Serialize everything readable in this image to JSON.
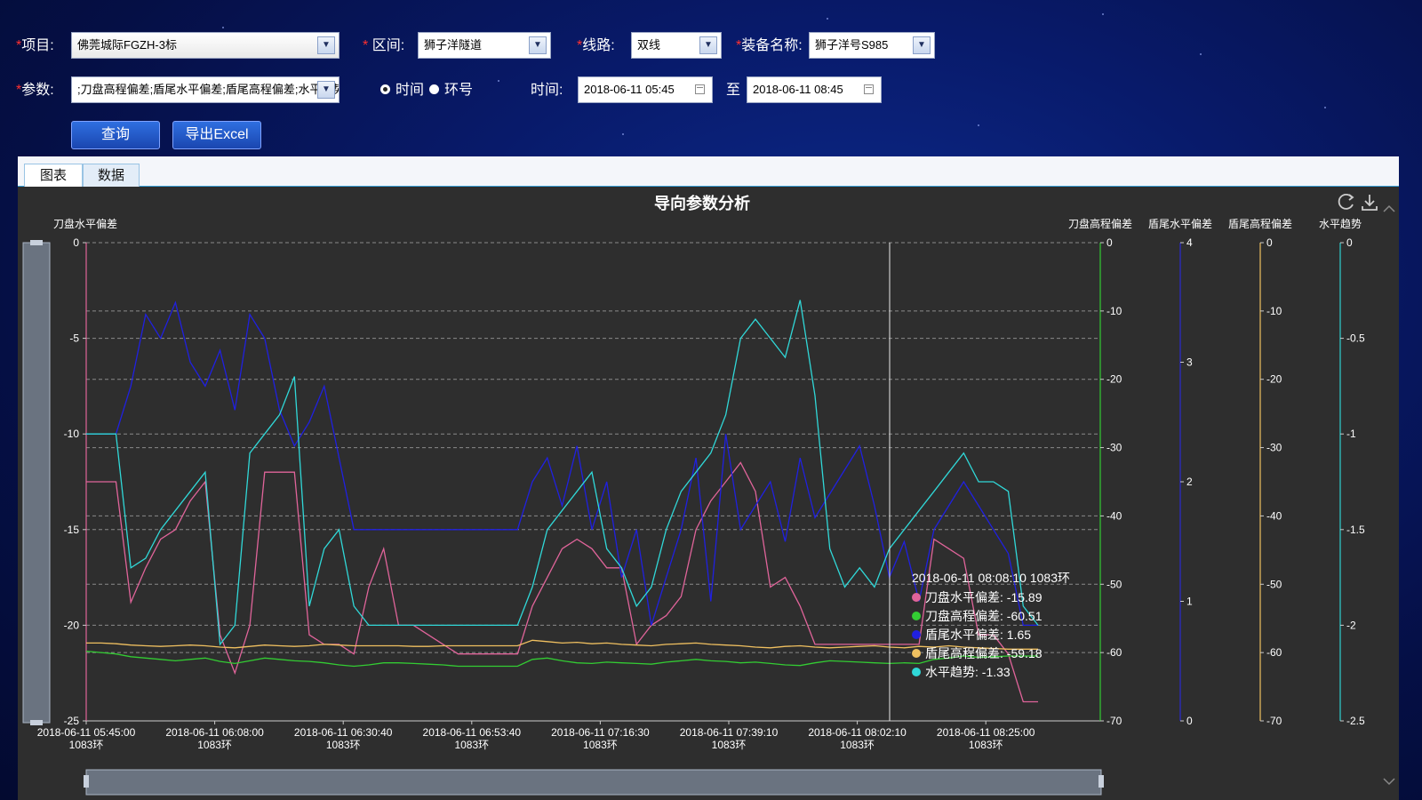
{
  "form": {
    "project_label": "项目:",
    "project_value": "佛莞城际FGZH-3标",
    "section_label": "区间:",
    "section_value": "狮子洋隧道",
    "line_label": "线路:",
    "line_value": "双线",
    "equipment_label": "装备名称:",
    "equipment_value": "狮子洋号S985",
    "params_label": "参数:",
    "params_value": ";刀盘高程偏差;盾尾水平偏差;盾尾高程偏差;水平趋势",
    "radio_time": "时间",
    "radio_ring": "环号",
    "radio_selected": "time",
    "time_label": "时间:",
    "time_from": "2018-06-11 05:45",
    "to_label": "至",
    "time_to": "2018-06-11 08:45",
    "required_mark": "*"
  },
  "buttons": {
    "query": "查询",
    "export": "导出Excel"
  },
  "tabs": [
    {
      "label": "图表",
      "active": true
    },
    {
      "label": "数据",
      "active": false
    }
  ],
  "chart_data": {
    "type": "line",
    "title": "导向参数分析",
    "x_ticks": [
      "2018-06-11 05:45:00",
      "2018-06-11 06:08:00",
      "2018-06-11 06:30:40",
      "2018-06-11 06:53:40",
      "2018-06-11 07:16:30",
      "2018-06-11 07:39:10",
      "2018-06-11 08:02:10",
      "2018-06-11 08:25:00"
    ],
    "x_tick_sub": "1083环",
    "axes": [
      {
        "id": "y0",
        "name": "刀盘水平偏差",
        "position": "left",
        "range": [
          -25,
          0
        ],
        "ticks": [
          0,
          -5,
          -10,
          -15,
          -20,
          -25
        ],
        "color": "#ffffff"
      },
      {
        "id": "y1",
        "name": "刀盘高程偏差",
        "position": "right",
        "range": [
          -70,
          0
        ],
        "ticks": [
          0,
          -10,
          -20,
          -30,
          -40,
          -50,
          -60,
          -70
        ],
        "color": "#33cc33"
      },
      {
        "id": "y2",
        "name": "盾尾水平偏差",
        "position": "right",
        "range": [
          0,
          4
        ],
        "ticks": [
          4,
          3,
          2,
          1,
          0
        ],
        "color": "#2a2ad0"
      },
      {
        "id": "y3",
        "name": "盾尾高程偏差",
        "position": "right",
        "range": [
          -70,
          0
        ],
        "ticks": [
          0,
          -10,
          -20,
          -30,
          -40,
          -50,
          -60,
          -70
        ],
        "color": "#f0c060"
      },
      {
        "id": "y4",
        "name": "水平趋势",
        "position": "right",
        "range": [
          -2.5,
          0
        ],
        "ticks": [
          0,
          -0.5,
          -1,
          -1.5,
          -2,
          -2.5
        ],
        "color": "#30d0d0"
      }
    ],
    "series": [
      {
        "name": "刀盘水平偏差",
        "axis": "y0",
        "color": "#e0649a",
        "values": [
          -12.5,
          -12.5,
          -12.5,
          -18.8,
          -17.0,
          -15.5,
          -15.0,
          -13.5,
          -12.5,
          -20.5,
          -22.5,
          -20.0,
          -12.0,
          -12.0,
          -12.0,
          -20.5,
          -21.0,
          -21.0,
          -21.5,
          -18.0,
          -16.0,
          -20.0,
          -20.0,
          -20.5,
          -21.0,
          -21.5,
          -21.5,
          -21.5,
          -21.5,
          -21.5,
          -19.0,
          -17.5,
          -16.0,
          -15.5,
          -16.0,
          -17.0,
          -17.0,
          -21.0,
          -20.0,
          -19.5,
          -18.5,
          -15.0,
          -13.5,
          -12.5,
          -11.5,
          -13.0,
          -18.0,
          -17.5,
          -19.0,
          -21.0,
          -21.0,
          -21.0,
          -21.0,
          -21.0,
          -21.0,
          -21.0,
          -21.0,
          -15.5,
          -16.0,
          -16.5,
          -20.5,
          -20.5,
          -21.5,
          -24.0,
          -24.0
        ]
      },
      {
        "name": "刀盘高程偏差",
        "axis": "y1",
        "color": "#33cc33",
        "values": [
          -59.8,
          -60.0,
          -60.2,
          -60.6,
          -60.8,
          -61.0,
          -61.2,
          -61.0,
          -60.8,
          -61.3,
          -61.6,
          -61.2,
          -60.8,
          -61.0,
          -61.2,
          -61.3,
          -61.5,
          -61.8,
          -62.0,
          -61.8,
          -61.5,
          -61.5,
          -61.6,
          -61.7,
          -61.8,
          -62.0,
          -62.0,
          -62.0,
          -62.0,
          -62.0,
          -61.0,
          -60.8,
          -61.2,
          -61.5,
          -61.6,
          -61.4,
          -61.5,
          -61.6,
          -61.7,
          -61.4,
          -61.2,
          -61.0,
          -61.2,
          -61.3,
          -61.5,
          -61.4,
          -61.6,
          -61.8,
          -61.9,
          -61.5,
          -61.2,
          -61.3,
          -61.4,
          -61.5,
          -61.6,
          -61.5,
          -61.6,
          -61.0,
          -60.8,
          -60.5,
          -60.7,
          -60.6,
          -60.5,
          -60.5,
          -60.5
        ]
      },
      {
        "name": "盾尾水平偏差",
        "axis": "y2",
        "color": "#2020e0",
        "values": [
          2.4,
          2.4,
          2.4,
          2.8,
          3.4,
          3.2,
          3.5,
          3.0,
          2.8,
          3.1,
          2.6,
          3.4,
          3.2,
          2.6,
          2.3,
          2.5,
          2.8,
          2.2,
          1.6,
          1.6,
          1.6,
          1.6,
          1.6,
          1.6,
          1.6,
          1.6,
          1.6,
          1.6,
          1.6,
          1.6,
          2.0,
          2.2,
          1.8,
          2.3,
          1.6,
          2.0,
          1.2,
          1.6,
          0.8,
          1.2,
          1.6,
          2.2,
          1.0,
          2.4,
          1.6,
          1.8,
          2.0,
          1.5,
          2.2,
          1.7,
          1.9,
          2.1,
          2.3,
          1.8,
          1.2,
          1.5,
          1.0,
          1.6,
          1.8,
          2.0,
          1.8,
          1.6,
          1.4,
          0.8,
          0.8
        ]
      },
      {
        "name": "盾尾高程偏差",
        "axis": "y3",
        "color": "#f0c060",
        "values": [
          -58.6,
          -58.6,
          -58.7,
          -58.9,
          -59.0,
          -59.1,
          -59.0,
          -58.9,
          -59.0,
          -59.2,
          -59.3,
          -59.1,
          -58.9,
          -59.0,
          -59.1,
          -59.0,
          -58.8,
          -58.9,
          -59.0,
          -59.0,
          -59.0,
          -59.0,
          -59.1,
          -59.1,
          -59.0,
          -59.0,
          -59.0,
          -59.0,
          -59.0,
          -59.0,
          -58.2,
          -58.4,
          -58.6,
          -58.5,
          -58.7,
          -58.6,
          -58.8,
          -58.9,
          -59.0,
          -58.8,
          -58.7,
          -58.6,
          -58.8,
          -58.9,
          -59.0,
          -59.2,
          -59.3,
          -59.1,
          -59.0,
          -59.2,
          -59.3,
          -59.2,
          -59.1,
          -59.0,
          -59.2,
          -59.3,
          -59.1,
          -59.2,
          -59.0,
          -59.2,
          -59.3,
          -59.4,
          -59.5,
          -59.5,
          -59.5
        ]
      },
      {
        "name": "水平趋势",
        "axis": "y4",
        "color": "#30d8d8",
        "values": [
          -1.0,
          -1.0,
          -1.0,
          -1.7,
          -1.65,
          -1.5,
          -1.4,
          -1.3,
          -1.2,
          -2.1,
          -2.0,
          -1.1,
          -1.0,
          -0.9,
          -0.7,
          -1.9,
          -1.6,
          -1.5,
          -1.9,
          -2.0,
          -2.0,
          -2.0,
          -2.0,
          -2.0,
          -2.0,
          -2.0,
          -2.0,
          -2.0,
          -2.0,
          -2.0,
          -1.8,
          -1.5,
          -1.4,
          -1.3,
          -1.2,
          -1.6,
          -1.7,
          -1.9,
          -1.8,
          -1.5,
          -1.3,
          -1.2,
          -1.1,
          -0.9,
          -0.5,
          -0.4,
          -0.5,
          -0.6,
          -0.3,
          -0.8,
          -1.6,
          -1.8,
          -1.7,
          -1.8,
          -1.6,
          -1.5,
          -1.4,
          -1.3,
          -1.2,
          -1.1,
          -1.25,
          -1.25,
          -1.3,
          -1.9,
          -2.0
        ]
      }
    ],
    "tooltip": {
      "title": "2018-06-11 08:08:10 1083环",
      "entries": [
        {
          "name": "刀盘水平偏差",
          "value": "-15.89",
          "color": "#e0649a"
        },
        {
          "name": "刀盘高程偏差",
          "value": "-60.51",
          "color": "#33cc33"
        },
        {
          "name": "盾尾水平偏差",
          "value": "1.65",
          "color": "#2020e0"
        },
        {
          "name": "盾尾高程偏差",
          "value": "-59.18",
          "color": "#f0c060"
        },
        {
          "name": "水平趋势",
          "value": "-1.33",
          "color": "#30d8d8"
        }
      ]
    },
    "grid": true,
    "legend": "none"
  },
  "icons": {
    "refresh": "refresh-icon",
    "download": "download-icon"
  }
}
